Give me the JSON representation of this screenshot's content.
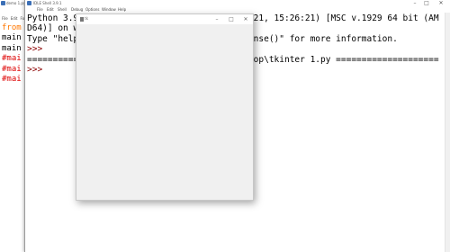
{
  "background_window": {
    "title": "demo 1.py",
    "menu": [
      "File",
      "Edit",
      "Fo"
    ],
    "code_lines": [
      {
        "text": "from",
        "color": "#ff7700"
      },
      {
        "text": "main",
        "color": "#000000"
      },
      {
        "text": "main",
        "color": "#000000"
      },
      {
        "text": "#mai",
        "color": "#dd0000"
      },
      {
        "text": "#mai",
        "color": "#dd0000"
      },
      {
        "text": "#mai",
        "color": "#dd0000"
      }
    ]
  },
  "shell": {
    "title": "IDLE Shell 3.9.1",
    "window_controls": {
      "minimize": "–",
      "maximize": "□",
      "close": "✕"
    },
    "menu": [
      "File",
      "Edit",
      "Shell",
      "Debug",
      "Options",
      "Window",
      "Help"
    ],
    "lines": [
      "Python 3.9.1 (tags/v3.9.1:1e5d33e, Dec  7 2021, 15:26:21) [MSC v.1929 64 bit (AM",
      "D64)] on win32",
      "Type \"help\", \"copyright\", \"credits\" or \"license()\" for more information.",
      ">>>",
      "==================== RESTART: C:\\Users\\Desktop\\tkinter 1.py ====================",
      ">>>"
    ]
  },
  "tk_window": {
    "title": "tk",
    "controls": {
      "minimize": "–",
      "maximize": "□",
      "close": "✕"
    }
  },
  "colors": {
    "prompt": "#8b0000",
    "keyword": "#ff7700",
    "comment": "#dd0000"
  }
}
